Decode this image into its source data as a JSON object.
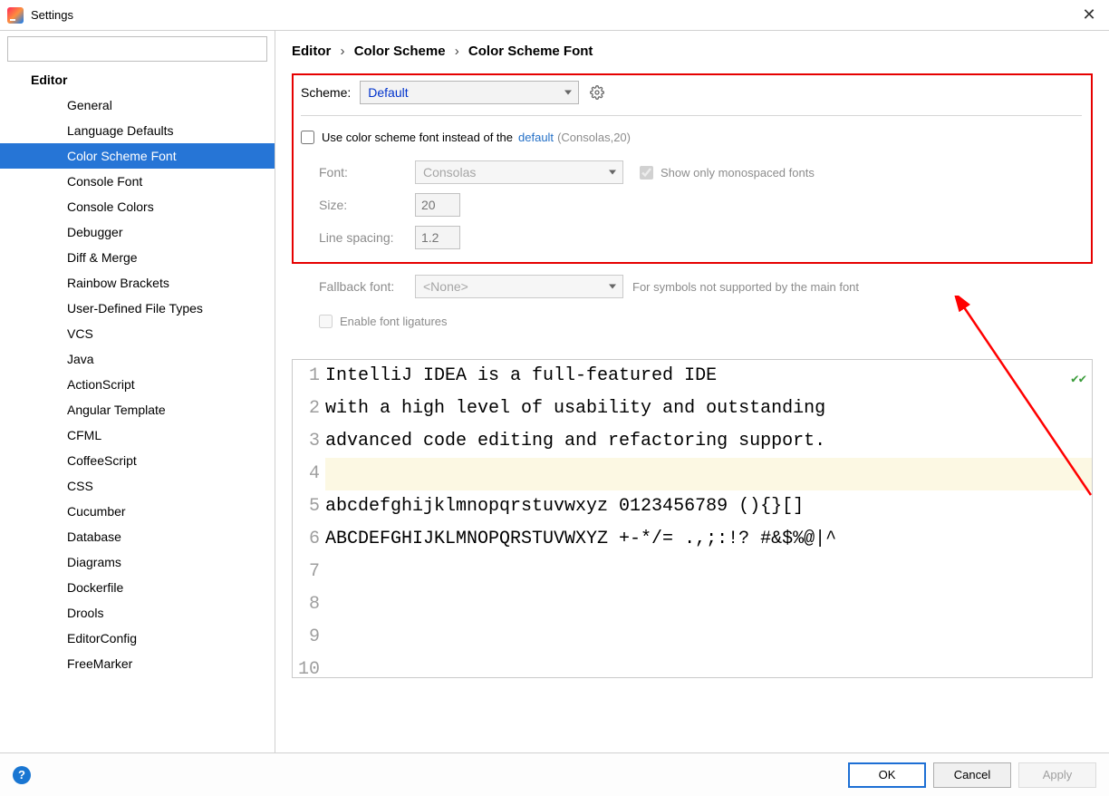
{
  "window": {
    "title": "Settings"
  },
  "search": {
    "placeholder": ""
  },
  "sidebar": {
    "section": "Editor",
    "items": [
      "General",
      "Language Defaults",
      "Color Scheme Font",
      "Console Font",
      "Console Colors",
      "Debugger",
      "Diff & Merge",
      "Rainbow Brackets",
      "User-Defined File Types",
      "VCS",
      "Java",
      "ActionScript",
      "Angular Template",
      "CFML",
      "CoffeeScript",
      "CSS",
      "Cucumber",
      "Database",
      "Diagrams",
      "Dockerfile",
      "Drools",
      "EditorConfig",
      "FreeMarker"
    ],
    "selected_index": 2
  },
  "breadcrumb": [
    "Editor",
    "Color Scheme",
    "Color Scheme Font"
  ],
  "scheme": {
    "label": "Scheme:",
    "value": "Default"
  },
  "use_scheme_font": {
    "checked": false,
    "label": "Use color scheme font instead of the",
    "link": "default",
    "hint": "(Consolas,20)"
  },
  "font": {
    "label": "Font:",
    "value": "Consolas"
  },
  "monospaced": {
    "checked": true,
    "label": "Show only monospaced fonts"
  },
  "size": {
    "label": "Size:",
    "value": "20"
  },
  "linespacing": {
    "label": "Line spacing:",
    "value": "1.2"
  },
  "fallback": {
    "label": "Fallback font:",
    "value": "<None>",
    "hint": "For symbols not supported by the main font"
  },
  "ligatures": {
    "checked": false,
    "label": "Enable font ligatures"
  },
  "preview": {
    "lines": [
      "IntelliJ IDEA is a full-featured IDE",
      "with a high level of usability and outstanding",
      "advanced code editing and refactoring support.",
      "",
      "abcdefghijklmnopqrstuvwxyz 0123456789 (){}[]",
      "ABCDEFGHIJKLMNOPQRSTUVWXYZ +-*/= .,;:!? #&$%@|^",
      "",
      "",
      "",
      ""
    ],
    "highlight_line": 3
  },
  "buttons": {
    "ok": "OK",
    "cancel": "Cancel",
    "apply": "Apply"
  }
}
